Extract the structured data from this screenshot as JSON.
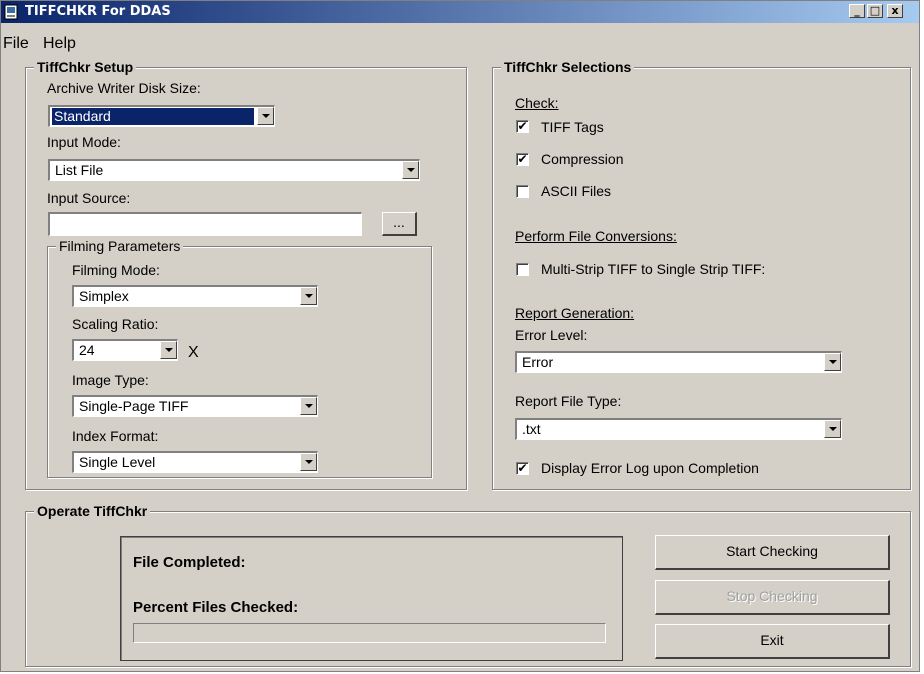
{
  "window": {
    "title": "TIFFCHKR For DDAS",
    "minimize_glyph": "_",
    "maximize_glyph": "□",
    "close_glyph": "x"
  },
  "menu": {
    "items": [
      "File",
      "Help"
    ]
  },
  "setup": {
    "title": "TiffChkr Setup",
    "disk_size_label": "Archive Writer Disk Size:",
    "disk_size_value": "Standard",
    "input_mode_label": "Input Mode:",
    "input_mode_value": "List File",
    "input_source_label": "Input Source:",
    "input_source_value": "",
    "browse_label": "...",
    "filming": {
      "title": "Filming Parameters",
      "mode_label": "Filming Mode:",
      "mode_value": "Simplex",
      "scaling_label": "Scaling Ratio:",
      "scaling_value": "24",
      "scaling_suffix": "X",
      "image_type_label": "Image Type:",
      "image_type_value": "Single-Page TIFF",
      "index_format_label": "Index Format:",
      "index_format_value": "Single Level"
    }
  },
  "selections": {
    "title": "TiffChkr Selections",
    "check_heading": "Check:",
    "checks": [
      {
        "label": "TIFF Tags",
        "checked": true
      },
      {
        "label": "Compression",
        "checked": true
      },
      {
        "label": "ASCII Files",
        "checked": false
      }
    ],
    "conversions_heading": "Perform File Conversions:",
    "conversion": {
      "label": "Multi-Strip TIFF to Single Strip TIFF:",
      "checked": false
    },
    "report_heading": "Report Generation:",
    "error_level_label": "Error Level:",
    "error_level_value": "Error",
    "report_type_label": "Report File Type:",
    "report_type_value": ".txt",
    "display_log": {
      "label": "Display Error Log upon Completion",
      "checked": true
    }
  },
  "operate": {
    "title": "Operate TiffChkr",
    "file_completed_label": "File Completed:",
    "percent_label": "Percent Files Checked:",
    "progress_fraction": 0,
    "start_label": "Start Checking",
    "stop_label": "Stop Checking",
    "exit_label": "Exit"
  },
  "colors": {
    "titlebar_start": "#0a246a",
    "titlebar_end": "#a6caf0",
    "face": "#d4d0c8",
    "selection": "#0a246a"
  }
}
